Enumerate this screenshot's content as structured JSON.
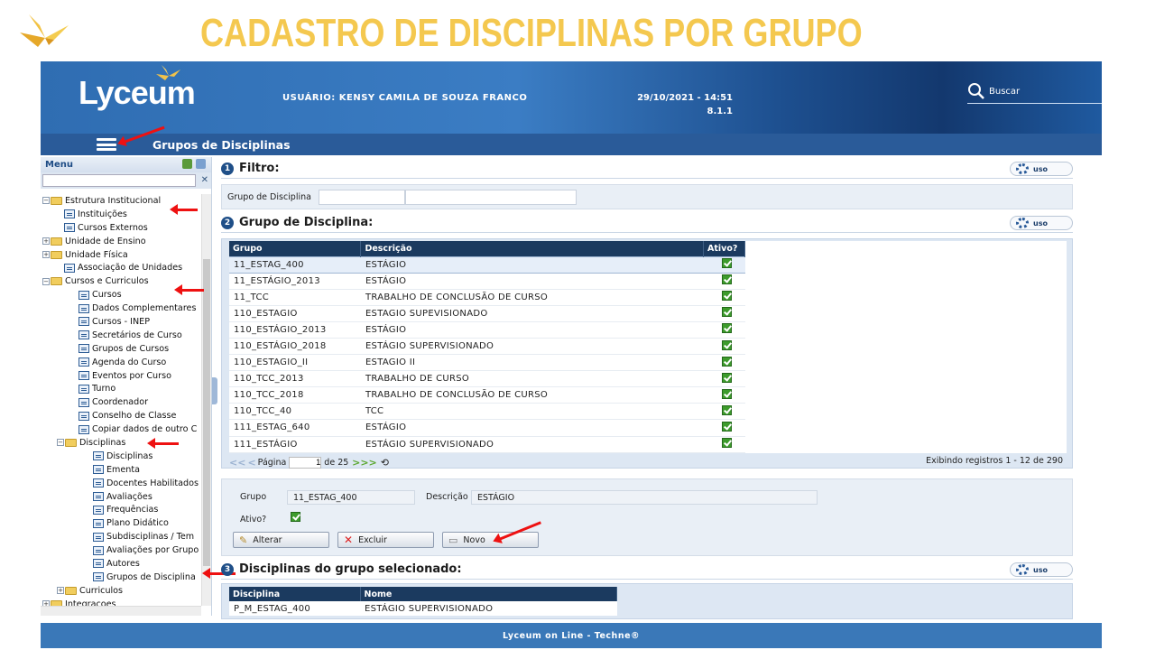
{
  "slide": {
    "title": "CADASTRO DE DISCIPLINAS POR GRUPO",
    "logo_icon": "origami-bird-icon"
  },
  "header": {
    "brand": "Lyceum",
    "user_label": "USUÁRIO: KENSY CAMILA DE SOUZA FRANCO",
    "datetime": "29/10/2021 - 14:51",
    "version": "8.1.1",
    "search_label": "Buscar"
  },
  "nav": {
    "title": "Grupos de Disciplinas"
  },
  "sidebar": {
    "title": "Menu",
    "items": [
      {
        "label": "Estrutura Institucional",
        "type": "folder",
        "level": 0,
        "expanded": true
      },
      {
        "label": "Instituições",
        "type": "page",
        "level": 1
      },
      {
        "label": "Cursos Externos",
        "type": "page",
        "level": 1
      },
      {
        "label": "Unidade de Ensino",
        "type": "folder",
        "level": 0,
        "expanded": false
      },
      {
        "label": "Unidade Física",
        "type": "folder",
        "level": 0,
        "expanded": false
      },
      {
        "label": "Associação de Unidades",
        "type": "page",
        "level": 1
      },
      {
        "label": "Cursos e Curriculos",
        "type": "folder",
        "level": 0,
        "expanded": true
      },
      {
        "label": "Cursos",
        "type": "page",
        "level": 2
      },
      {
        "label": "Dados Complementares",
        "type": "page",
        "level": 2
      },
      {
        "label": "Cursos - INEP",
        "type": "page",
        "level": 2
      },
      {
        "label": "Secretários de Curso",
        "type": "page",
        "level": 2
      },
      {
        "label": "Grupos de Cursos",
        "type": "page",
        "level": 2
      },
      {
        "label": "Agenda do Curso",
        "type": "page",
        "level": 2
      },
      {
        "label": "Eventos por Curso",
        "type": "page",
        "level": 2
      },
      {
        "label": "Turno",
        "type": "page",
        "level": 2
      },
      {
        "label": "Coordenador",
        "type": "page",
        "level": 2
      },
      {
        "label": "Conselho de Classe",
        "type": "page",
        "level": 2
      },
      {
        "label": "Copiar dados de outro C",
        "type": "page",
        "level": 2
      },
      {
        "label": "Disciplinas",
        "type": "folder",
        "level": 1,
        "expanded": true
      },
      {
        "label": "Disciplinas",
        "type": "page",
        "level": 3
      },
      {
        "label": "Ementa",
        "type": "page",
        "level": 3
      },
      {
        "label": "Docentes Habilitados",
        "type": "page",
        "level": 3
      },
      {
        "label": "Avaliações",
        "type": "page",
        "level": 3
      },
      {
        "label": "Frequências",
        "type": "page",
        "level": 3
      },
      {
        "label": "Plano Didático",
        "type": "page",
        "level": 3
      },
      {
        "label": "Subdisciplinas / Tem",
        "type": "page",
        "level": 3
      },
      {
        "label": "Avaliações por Grupo",
        "type": "page",
        "level": 3
      },
      {
        "label": "Autores",
        "type": "page",
        "level": 3
      },
      {
        "label": "Grupos de Disciplina",
        "type": "page",
        "level": 3
      },
      {
        "label": "Curriculos",
        "type": "folder",
        "level": 1,
        "expanded": false
      },
      {
        "label": "Integracoes",
        "type": "folder",
        "level": 0,
        "expanded": false
      }
    ]
  },
  "filter": {
    "title": "Filtro:",
    "number": "1",
    "field_label": "Grupo de Disciplina",
    "uso": "uso"
  },
  "group": {
    "title": "Grupo de Disciplina:",
    "number": "2",
    "uso": "uso",
    "columns": [
      "Grupo",
      "Descrição",
      "Ativo?"
    ],
    "rows": [
      [
        "11_ESTAG_400",
        "ESTÁGIO"
      ],
      [
        "11_ESTÁGIO_2013",
        "ESTÁGIO"
      ],
      [
        "11_TCC",
        "TRABALHO DE CONCLUSÃO DE CURSO"
      ],
      [
        "110_ESTAGIO",
        "ESTAGIO SUPEVISIONADO"
      ],
      [
        "110_ESTÁGIO_2013",
        "ESTÁGIO"
      ],
      [
        "110_ESTÁGIO_2018",
        "ESTÁGIO SUPERVISIONADO"
      ],
      [
        "110_ESTAGIO_II",
        "ESTAGIO II"
      ],
      [
        "110_TCC_2013",
        "TRABALHO DE CURSO"
      ],
      [
        "110_TCC_2018",
        "TRABALHO DE CONCLUSÃO DE CURSO"
      ],
      [
        "110_TCC_40",
        "TCC"
      ],
      [
        "111_ESTAG_640",
        "ESTÁGIO"
      ],
      [
        "111_ESTÁGIO",
        "ESTÁGIO SUPERVISIONADO"
      ]
    ],
    "pager": {
      "label": "Página",
      "page": "1",
      "of": "de 25",
      "count": "Exibindo registros 1 - 12 de 290"
    }
  },
  "detail": {
    "grupo_label": "Grupo",
    "grupo_value": "11_ESTAG_400",
    "descricao_label": "Descrição",
    "descricao_value": "ESTÁGIO",
    "ativo_label": "Ativo?",
    "btn_alterar": "Alterar",
    "btn_excluir": "Excluir",
    "btn_novo": "Novo"
  },
  "subgrid": {
    "title": "Disciplinas do grupo selecionado:",
    "number": "3",
    "uso": "uso",
    "columns": [
      "Disciplina",
      "Nome"
    ],
    "rows": [
      [
        "P_M_ESTAG_400",
        "ESTÁGIO SUPERVISIONADO"
      ]
    ]
  },
  "footer": {
    "text": "Lyceum on Line - Techne®"
  },
  "colors": {
    "title_yellow": "#f4c84f",
    "header_blue": "#2f6db2",
    "grid_header": "#1b3a5f",
    "arrow_red": "#ee1111"
  }
}
